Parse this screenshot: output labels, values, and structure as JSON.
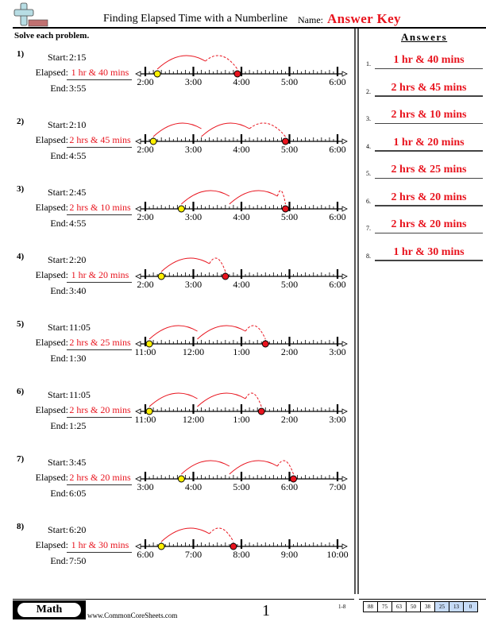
{
  "header": {
    "title": "Finding Elapsed Time with a Numberline",
    "name_label": "Name:",
    "name_value": "Answer Key",
    "logo": "math-plus-icon"
  },
  "instructions": "Solve each problem.",
  "labels": {
    "start": "Start:",
    "elapsed": "Elapsed:",
    "end": "End:"
  },
  "accent_color": "#e8141e",
  "problems": [
    {
      "num": "1)",
      "start": "2:15",
      "elapsed": "1 hr & 40 mins",
      "end": "3:55",
      "ticks": [
        "2:00",
        "3:00",
        "4:00",
        "5:00",
        "6:00"
      ],
      "start_offset_min": 15,
      "end_offset_min": 115
    },
    {
      "num": "2)",
      "start": "2:10",
      "elapsed": "2 hrs & 45 mins",
      "end": "4:55",
      "ticks": [
        "2:00",
        "3:00",
        "4:00",
        "5:00",
        "6:00"
      ],
      "start_offset_min": 10,
      "end_offset_min": 175
    },
    {
      "num": "3)",
      "start": "2:45",
      "elapsed": "2 hrs & 10 mins",
      "end": "4:55",
      "ticks": [
        "2:00",
        "3:00",
        "4:00",
        "5:00",
        "6:00"
      ],
      "start_offset_min": 45,
      "end_offset_min": 175
    },
    {
      "num": "4)",
      "start": "2:20",
      "elapsed": "1 hr & 20 mins",
      "end": "3:40",
      "ticks": [
        "2:00",
        "3:00",
        "4:00",
        "5:00",
        "6:00"
      ],
      "start_offset_min": 20,
      "end_offset_min": 100
    },
    {
      "num": "5)",
      "start": "11:05",
      "elapsed": "2 hrs & 25 mins",
      "end": "1:30",
      "ticks": [
        "11:00",
        "12:00",
        "1:00",
        "2:00",
        "3:00"
      ],
      "start_offset_min": 5,
      "end_offset_min": 150
    },
    {
      "num": "6)",
      "start": "11:05",
      "elapsed": "2 hrs & 20 mins",
      "end": "1:25",
      "ticks": [
        "11:00",
        "12:00",
        "1:00",
        "2:00",
        "3:00"
      ],
      "start_offset_min": 5,
      "end_offset_min": 145
    },
    {
      "num": "7)",
      "start": "3:45",
      "elapsed": "2 hrs & 20 mins",
      "end": "6:05",
      "ticks": [
        "3:00",
        "4:00",
        "5:00",
        "6:00",
        "7:00"
      ],
      "start_offset_min": 45,
      "end_offset_min": 185
    },
    {
      "num": "8)",
      "start": "6:20",
      "elapsed": "1 hr & 30 mins",
      "end": "7:50",
      "ticks": [
        "6:00",
        "7:00",
        "8:00",
        "9:00",
        "10:00"
      ],
      "start_offset_min": 20,
      "end_offset_min": 110
    }
  ],
  "answers": {
    "heading": "Answers",
    "items": [
      {
        "num": "1.",
        "text": "1 hr & 40 mins"
      },
      {
        "num": "2.",
        "text": "2 hrs & 45 mins"
      },
      {
        "num": "3.",
        "text": "2 hrs & 10 mins"
      },
      {
        "num": "4.",
        "text": "1 hr & 20 mins"
      },
      {
        "num": "5.",
        "text": "2 hrs & 25 mins"
      },
      {
        "num": "6.",
        "text": "2 hrs & 20 mins"
      },
      {
        "num": "7.",
        "text": "2 hrs & 20 mins"
      },
      {
        "num": "8.",
        "text": "1 hr & 30 mins"
      }
    ]
  },
  "footer": {
    "subject": "Math",
    "website": "www.CommonCoreSheets.com",
    "page": "1",
    "range": "1-8",
    "scores": [
      "88",
      "75",
      "63",
      "50",
      "38",
      "25",
      "13",
      "0"
    ],
    "highlighted_scores": [
      "25",
      "13",
      "0"
    ]
  }
}
